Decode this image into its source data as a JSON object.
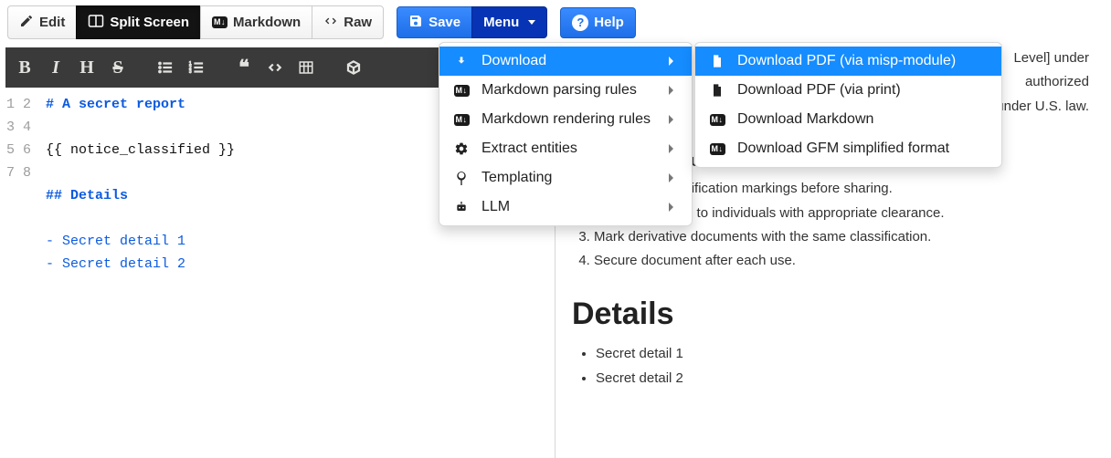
{
  "toolbar": {
    "edit": "Edit",
    "split": "Split Screen",
    "markdown": "Markdown",
    "raw": "Raw",
    "save": "Save",
    "menu": "Menu",
    "help": "Help"
  },
  "menu": {
    "download": "Download",
    "parsing": "Markdown parsing rules",
    "rendering": "Markdown rendering rules",
    "extract": "Extract entities",
    "templating": "Templating",
    "llm": "LLM"
  },
  "submenu": {
    "pdf_module": "Download PDF (via misp-module)",
    "pdf_print": "Download PDF (via print)",
    "dl_md": "Download Markdown",
    "dl_gfm": "Download GFM simplified format"
  },
  "editor": {
    "lines": [
      "# A secret report",
      "",
      "{{ notice_classified }}",
      "",
      "## Details",
      "",
      "- Secret detail 1",
      "- Secret detail 2"
    ],
    "line_numbers": [
      "1",
      "2",
      "3",
      "4",
      "5",
      "6",
      "7",
      "8"
    ]
  },
  "preview": {
    "partial_line1_tail": "Level] under",
    "partial_line2_tail": "authorized",
    "partial_line3": "in criminal penalties under U.S. law.",
    "handling_label": "UCTIONS",
    "handling_colon": ":",
    "instructions": [
      "Review all classification markings before sharing.",
      "Limit distribution to individuals with appropriate clearance.",
      "Mark derivative documents with the same classification.",
      "Secure document after each use."
    ],
    "details_heading": "Details",
    "details": [
      "Secret detail 1",
      "Secret detail 2"
    ]
  }
}
